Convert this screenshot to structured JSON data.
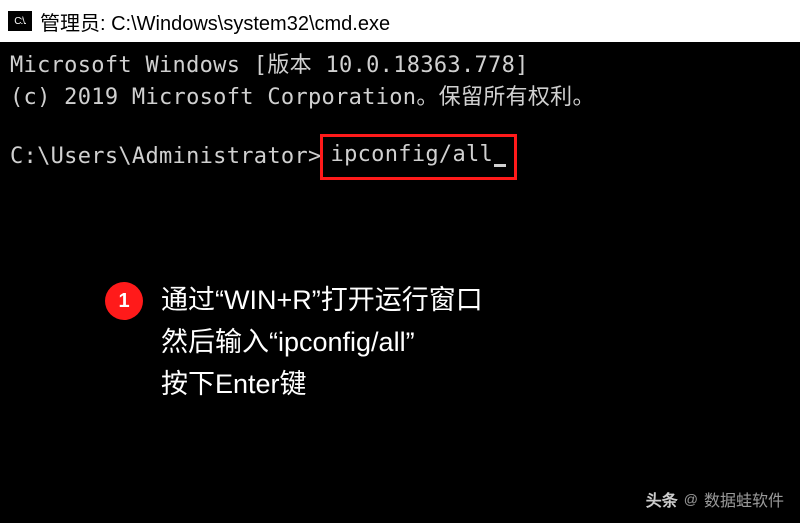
{
  "titlebar": {
    "icon_text": "C:\\.",
    "title": "管理员: C:\\Windows\\system32\\cmd.exe"
  },
  "terminal": {
    "line1": "Microsoft Windows [版本 10.0.18363.778]",
    "line2": "(c) 2019 Microsoft Corporation。保留所有权利。",
    "prompt": "C:\\Users\\Administrator>",
    "command": "ipconfig/all"
  },
  "annotation": {
    "step": "1",
    "line1": "通过“WIN+R”打开运行窗口",
    "line2": "然后输入“ipconfig/all”",
    "line3": "按下Enter键"
  },
  "watermark": {
    "label": "头条",
    "at": "@",
    "name": "数据蛙软件"
  }
}
